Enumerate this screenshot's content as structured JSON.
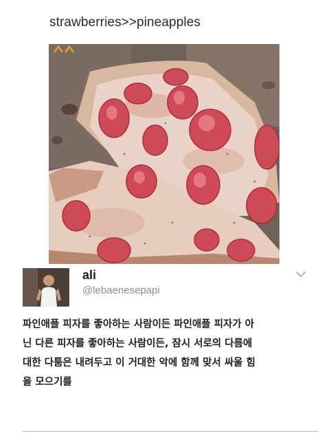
{
  "post": {
    "caption": "strawberries>>pineapples"
  },
  "tweet": {
    "user_name": "ali",
    "handle": "@lebaenesepapi",
    "icons": {
      "avatar": "profile-photo",
      "menu": "chevron-down-icon"
    },
    "body_lines": [
      "파인애플 피자를 좋아하는 사람이든 파인애플 피자가 아",
      "닌 다른 피자를 좋아하는 사람이든, 잠시 서로의 다름에",
      "대한 다툼은 내려두고 이 거대한 악에 함께 맞서 싸울 힘",
      "을 모으기를"
    ]
  },
  "colors": {
    "handle_gray": "#8a8f96",
    "chevron_gray": "#b0b4ba",
    "divider": "#b9b9b9"
  }
}
